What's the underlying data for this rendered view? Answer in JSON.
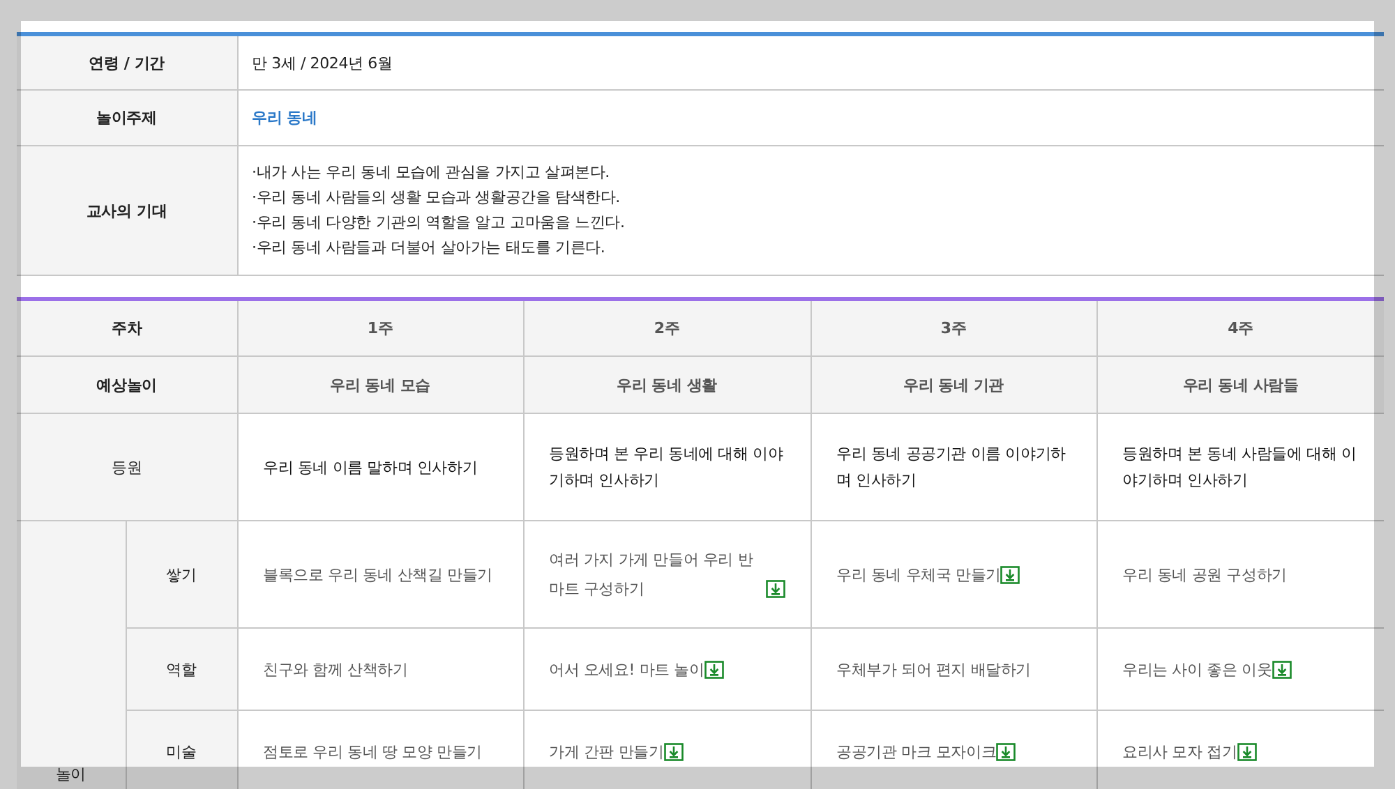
{
  "info": [
    {
      "label": "연령 / 기간",
      "kind": "plain",
      "value": "만 3세 / 2024년 6월"
    },
    {
      "label": "놀이주제",
      "kind": "link",
      "value": "우리 동네"
    },
    {
      "label": "교사의 기대",
      "kind": "list",
      "items": [
        "·내가 사는 우리 동네 모습에 관심을 가지고 살펴본다.",
        "·우리 동네 사람들의 생활 모습과 생활공간을 탐색한다.",
        "·우리 동네 다양한 기관의 역할을 알고 고마움을 느낀다.",
        "·우리 동네 사람들과 더불어 살아가는 태도를 기른다."
      ]
    }
  ],
  "plan": {
    "week_label": "주차",
    "weeks": [
      "1주",
      "2주",
      "3주",
      "4주"
    ],
    "theme_label": "예상놀이",
    "themes": [
      "우리 동네 모습",
      "우리 동네 생활",
      "우리 동네 기관",
      "우리 동네 사람들"
    ],
    "arrival": {
      "label": "등원",
      "cells": [
        "우리 동네 이름 말하며 인사하기",
        "등원하며 본 우리 동네에 대해 이야기하며 인사하기",
        "우리 동네 공공기관 이름 이야기하며 인사하기",
        "등원하며 본 동네 사람들에 대해 이야기하며 인사하기"
      ]
    },
    "play": {
      "label": "놀이",
      "rows": [
        {
          "label": "쌓기",
          "cells": [
            {
              "text": "블록으로 우리 동네 산책길 만들기",
              "download": false
            },
            {
              "text": "여러 가지 가게 만들어 우리 반 마트 구성하기",
              "download": true
            },
            {
              "text": "우리 동네 우체국 만들기",
              "download": true
            },
            {
              "text": "우리 동네 공원 구성하기",
              "download": false
            }
          ]
        },
        {
          "label": "역할",
          "cells": [
            {
              "text": "친구와 함께 산책하기",
              "download": false
            },
            {
              "text": "어서 오세요! 마트 놀이",
              "download": true
            },
            {
              "text": "우체부가 되어 편지 배달하기",
              "download": false
            },
            {
              "text": "우리는 사이 좋은 이웃",
              "download": true
            }
          ]
        },
        {
          "label": "미술",
          "cells": [
            {
              "text": "점토로 우리 동네 땅 모양 만들기",
              "download": false
            },
            {
              "text": "가게 간판 만들기",
              "download": true
            },
            {
              "text": "공공기관 마크 모자이크",
              "download": true
            },
            {
              "text": "요리사 모자 접기",
              "download": true
            }
          ]
        }
      ]
    }
  }
}
